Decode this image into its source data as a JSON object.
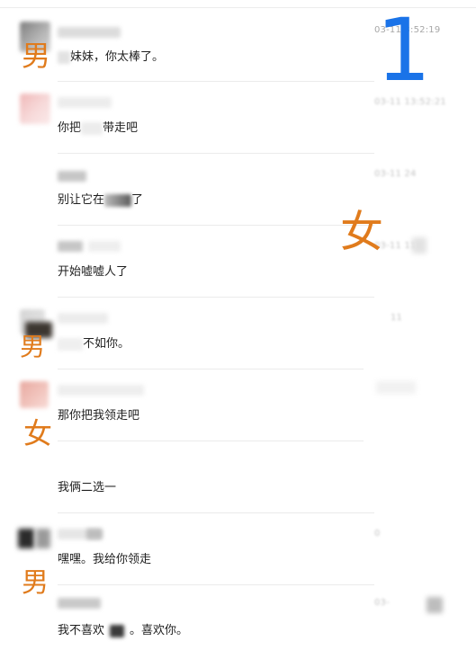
{
  "overlay": {
    "number": "1",
    "labels": {
      "male": "男",
      "female": "女"
    }
  },
  "messages": [
    {
      "time": "03-11  3:52:19",
      "text": "妹妹，你太棒了。"
    },
    {
      "time": "03-11 13:52:21",
      "text_before": "你把",
      "text_after": "带走吧"
    },
    {
      "time": "03-11  24",
      "text_before": "别让它在",
      "text_after": "了"
    },
    {
      "time": "03-11  11",
      "text": "开始嘘嘘人了"
    },
    {
      "time": "11",
      "text": "不如你。"
    },
    {
      "time": "",
      "text": "那你把我领走吧"
    },
    {
      "time": "",
      "text": "我俩二选一"
    },
    {
      "time": "0",
      "text": "嘿嘿。我给你领走"
    },
    {
      "time": "03-",
      "text_before": "我不喜欢",
      "text_after": "。喜欢你。"
    }
  ],
  "colors": {
    "label_orange": "#e07b1c",
    "number_blue": "#1a73e8",
    "text": "#1f1f1f",
    "time": "#a7a7a7"
  }
}
